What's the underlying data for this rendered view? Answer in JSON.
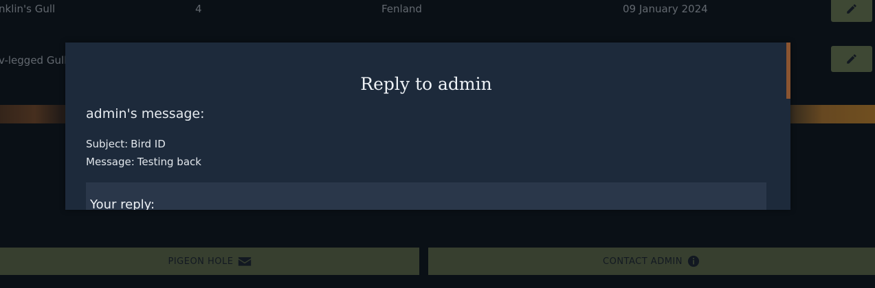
{
  "table": {
    "rows": [
      {
        "name": "nklin's Gull",
        "count": "4",
        "location": "Fenland",
        "date": "09 January 2024"
      },
      {
        "name": "v-legged Gull",
        "count": "",
        "location": "",
        "date": ""
      }
    ]
  },
  "icons": {
    "edit": "pencil-icon",
    "envelope": "envelope-icon",
    "info": "info-circle-icon"
  },
  "colors": {
    "background": "#0d141c",
    "modal": "#1d2a3b",
    "reply_panel": "#2a374a",
    "button": "#5f6b4a",
    "edit_button": "#6c7a52"
  },
  "modal": {
    "title": "Reply to admin",
    "message_heading": "admin's message:",
    "subject_label": "Subject:",
    "subject_value": "Bird ID",
    "message_label": "Message:",
    "message_value": "Testing back",
    "reply_heading": "Your reply:"
  },
  "footer": {
    "pigeon_hole_label": "PIGEON HOLE",
    "contact_admin_label": "CONTACT ADMIN"
  }
}
